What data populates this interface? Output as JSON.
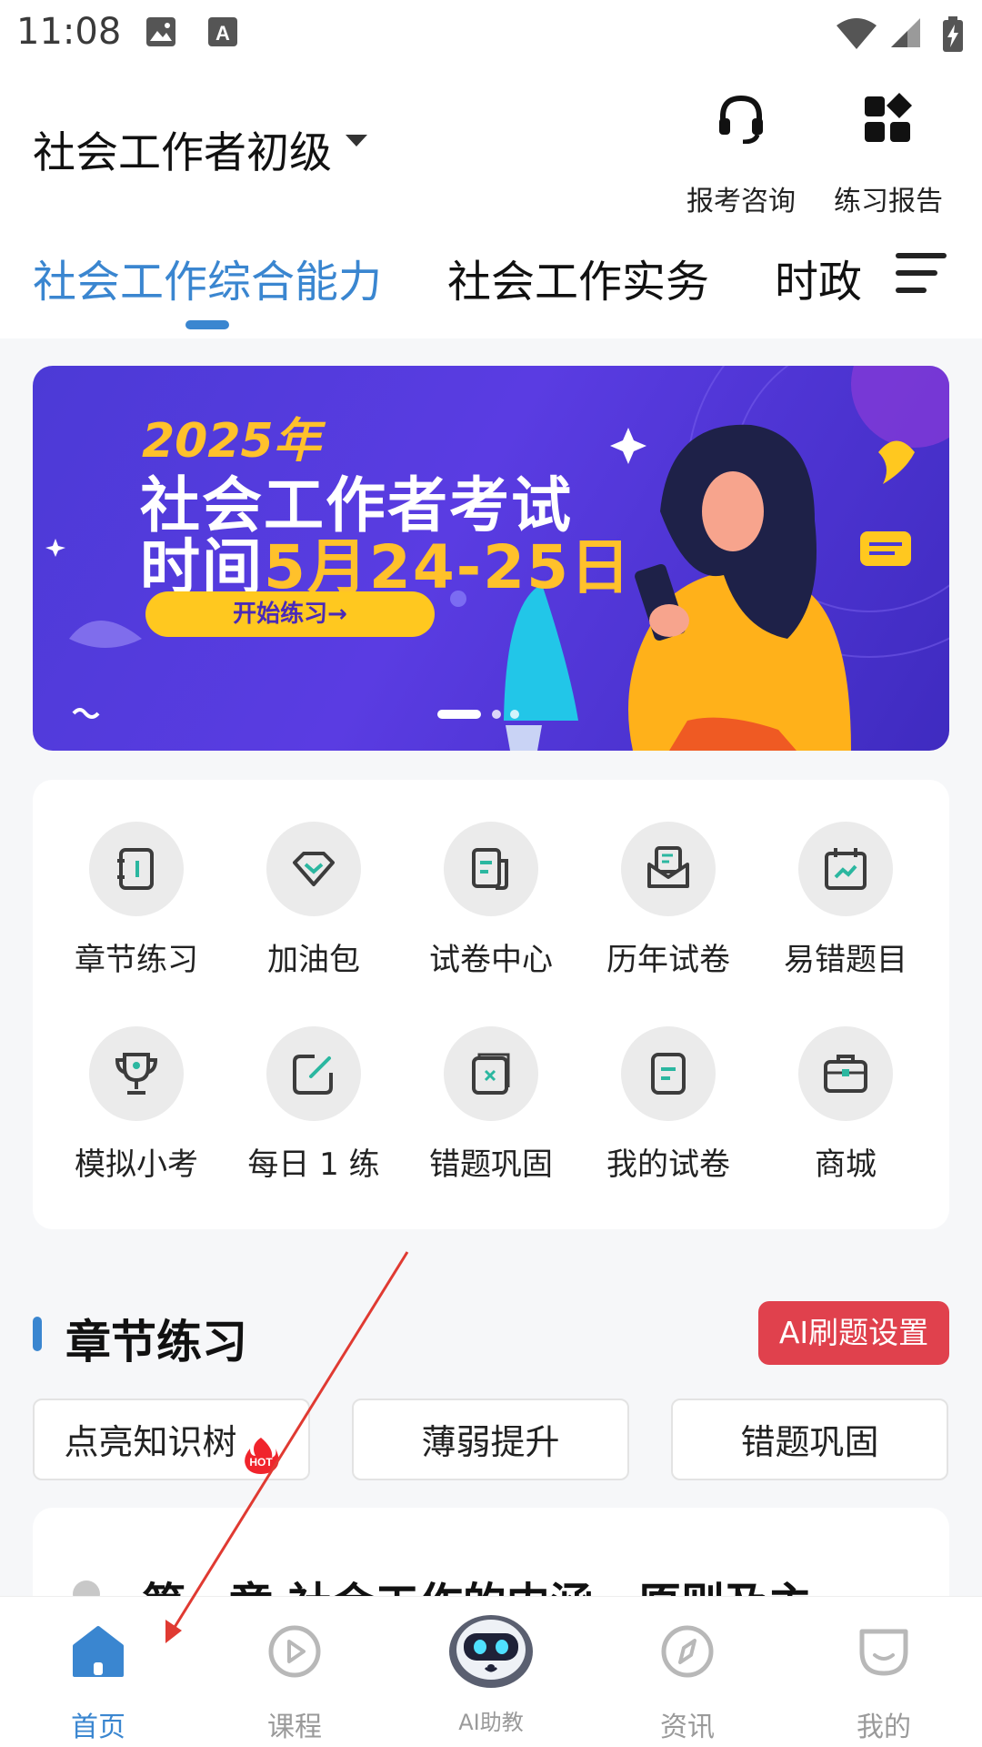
{
  "status_bar": {
    "time": "11:08"
  },
  "header": {
    "exam_title": "社会工作者初级",
    "consult_label": "报考咨询",
    "report_label": "练习报告"
  },
  "tabs": [
    {
      "label": "社会工作综合能力",
      "active": true
    },
    {
      "label": "社会工作实务",
      "active": false
    },
    {
      "label": "时政",
      "active": false
    }
  ],
  "banner": {
    "year": "2025年",
    "line1": "社会工作者考试",
    "line2_prefix": "时间",
    "line2_highlight": "5月24-25日",
    "button": "开始练习→",
    "page_count": 3,
    "active_page": 1
  },
  "functions": [
    {
      "label": "章节练习",
      "icon": "notebook-icon"
    },
    {
      "label": "加油包",
      "icon": "diamond-icon"
    },
    {
      "label": "试卷中心",
      "icon": "paper-stack-icon"
    },
    {
      "label": "历年试卷",
      "icon": "envelope-doc-icon"
    },
    {
      "label": "易错题目",
      "icon": "calendar-chart-icon"
    },
    {
      "label": "模拟小考",
      "icon": "trophy-icon"
    },
    {
      "label": "每日 1 练",
      "icon": "edit-square-icon"
    },
    {
      "label": "错题巩固",
      "icon": "wrong-book-icon"
    },
    {
      "label": "我的试卷",
      "icon": "my-paper-icon"
    },
    {
      "label": "商城",
      "icon": "briefcase-icon"
    }
  ],
  "section": {
    "title": "章节练习",
    "ai_button": "AI刷题设置"
  },
  "chips": [
    {
      "label": "点亮知识树",
      "badge": "HOT"
    },
    {
      "label": "薄弱提升"
    },
    {
      "label": "错题巩固"
    }
  ],
  "chapter": {
    "title": "第一章 社会工作的内涵、原则及主"
  },
  "bottom_nav": [
    {
      "label": "首页",
      "icon": "home-icon",
      "active": true
    },
    {
      "label": "课程",
      "icon": "play-circle-icon",
      "active": false
    },
    {
      "label": "AI助教",
      "icon": "robot-avatar-icon",
      "active": false
    },
    {
      "label": "资讯",
      "icon": "compass-icon",
      "active": false
    },
    {
      "label": "我的",
      "icon": "profile-face-icon",
      "active": false
    }
  ],
  "colors": {
    "accent": "#3a86d0",
    "icon_green": "#2bb7a0",
    "icon_dark": "#3c3c3c",
    "ai_button": "#e0414d",
    "banner_bg": "#4c3ad6",
    "banner_highlight": "#ffc12b"
  }
}
